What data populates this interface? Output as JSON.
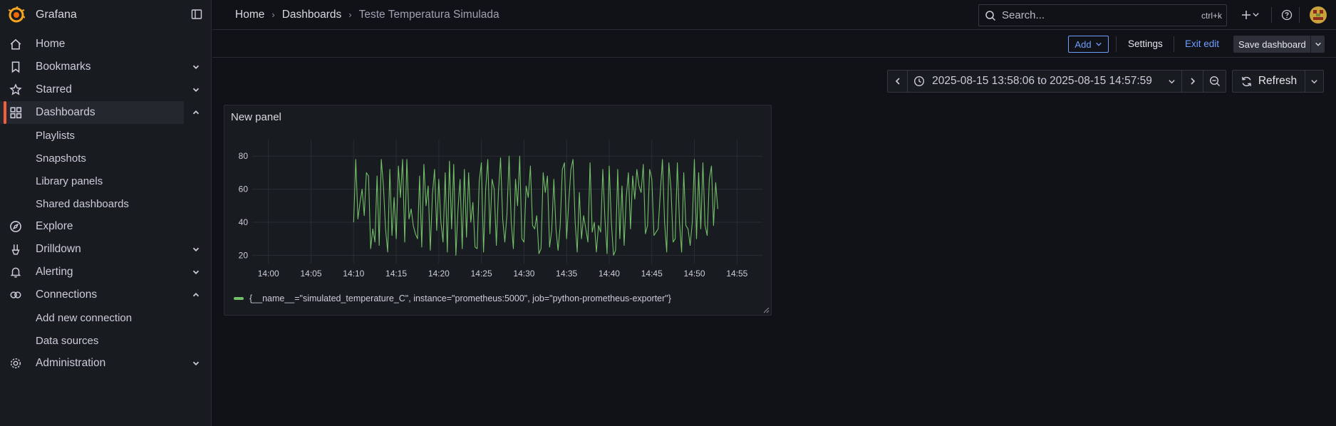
{
  "app": {
    "name": "Grafana"
  },
  "sidebar": {
    "items": [
      {
        "label": "Home",
        "icon": "home-icon",
        "chevron": ""
      },
      {
        "label": "Bookmarks",
        "icon": "bookmark-icon",
        "chevron": "down"
      },
      {
        "label": "Starred",
        "icon": "star-icon",
        "chevron": "down"
      },
      {
        "label": "Dashboards",
        "icon": "apps-icon",
        "chevron": "up",
        "active": true
      },
      {
        "label": "Playlists",
        "sub": true
      },
      {
        "label": "Snapshots",
        "sub": true
      },
      {
        "label": "Library panels",
        "sub": true
      },
      {
        "label": "Shared dashboards",
        "sub": true
      },
      {
        "label": "Explore",
        "icon": "compass-icon",
        "chevron": ""
      },
      {
        "label": "Drilldown",
        "icon": "drilldown-icon",
        "chevron": "down"
      },
      {
        "label": "Alerting",
        "icon": "bell-icon",
        "chevron": "down"
      },
      {
        "label": "Connections",
        "icon": "connections-icon",
        "chevron": "up"
      },
      {
        "label": "Add new connection",
        "sub": true
      },
      {
        "label": "Data sources",
        "sub": true
      },
      {
        "label": "Administration",
        "icon": "cog-icon",
        "chevron": "down"
      }
    ]
  },
  "breadcrumb": {
    "home": "Home",
    "dashboards": "Dashboards",
    "current": "Teste Temperatura Simulada"
  },
  "search": {
    "placeholder": "Search...",
    "shortcut": "ctrl+k"
  },
  "toolbar": {
    "add_label": "Add",
    "settings_label": "Settings",
    "exit_edit_label": "Exit edit",
    "save_label": "Save dashboard"
  },
  "timepicker": {
    "from": "2025-08-15 13:58:06",
    "to_word": "to",
    "to": "2025-08-15 14:57:59",
    "refresh_label": "Refresh"
  },
  "panel": {
    "title": "New panel"
  },
  "colors": {
    "series": "#73bf69",
    "accent": "#6e9fff",
    "brand": "#f55f3e"
  },
  "chart_data": {
    "type": "line",
    "title": "New panel",
    "ylim": [
      15,
      90
    ],
    "yticks": [
      20,
      40,
      60,
      80
    ],
    "xlim": [
      "13:58:06",
      "14:57:59"
    ],
    "xticks": [
      "14:00",
      "14:05",
      "14:10",
      "14:15",
      "14:20",
      "14:25",
      "14:30",
      "14:35",
      "14:40",
      "14:45",
      "14:50",
      "14:55"
    ],
    "grid": true,
    "legend_placement": "bottom-left",
    "series": [
      {
        "name": "{__name__=\"simulated_temperature_C\", instance=\"prometheus:5000\", job=\"python-prometheus-exporter\"}",
        "start": "14:10:00",
        "step_seconds": 15,
        "values": [
          40,
          78,
          42,
          52,
          60,
          44,
          70,
          68,
          24,
          36,
          28,
          68,
          26,
          78,
          62,
          36,
          22,
          72,
          32,
          55,
          30,
          74,
          55,
          78,
          28,
          78,
          42,
          48,
          38,
          33,
          30,
          68,
          25,
          75,
          50,
          62,
          23,
          57,
          72,
          35,
          66,
          40,
          28,
          70,
          22,
          77,
          36,
          75,
          20,
          48,
          66,
          24,
          72,
          31,
          70,
          40,
          52,
          25,
          24,
          65,
          76,
          22,
          60,
          78,
          33,
          66,
          60,
          26,
          58,
          79,
          42,
          28,
          45,
          80,
          40,
          24,
          66,
          50,
          80,
          30,
          28,
          62,
          55,
          74,
          38,
          36,
          44,
          21,
          24,
          70,
          58,
          68,
          25,
          35,
          66,
          36,
          23,
          38,
          72,
          76,
          30,
          52,
          72,
          78,
          40,
          22,
          58,
          30,
          44,
          36,
          28,
          76,
          34,
          40,
          22,
          38,
          34,
          72,
          42,
          21,
          74,
          40,
          20,
          23,
          72,
          30,
          62,
          26,
          55,
          70,
          36,
          68,
          54,
          72,
          62,
          58,
          75,
          33,
          38,
          72,
          66,
          32,
          34,
          36,
          58,
          78,
          40,
          22,
          76,
          60,
          28,
          30,
          76,
          40,
          22,
          70,
          38,
          36,
          26,
          40,
          78,
          30,
          70,
          36,
          76,
          38,
          32,
          66,
          74,
          38,
          64,
          48
        ]
      }
    ]
  }
}
